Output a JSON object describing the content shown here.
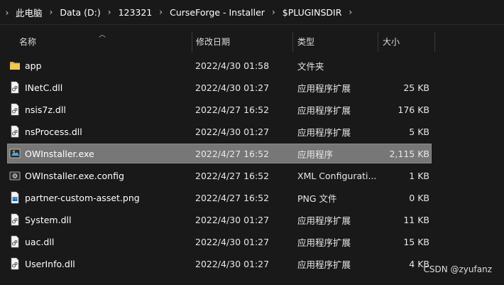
{
  "breadcrumb": {
    "items": [
      "此电脑",
      "Data (D:)",
      "123321",
      "CurseForge - Installer",
      "$PLUGINSDIR"
    ]
  },
  "columns": {
    "name": "名称",
    "date": "修改日期",
    "type": "类型",
    "size": "大小"
  },
  "files": [
    {
      "name": "app",
      "date": "2022/4/30 01:58",
      "type": "文件夹",
      "size": "",
      "icon": "folder-icon"
    },
    {
      "name": "INetC.dll",
      "date": "2022/4/30 01:27",
      "type": "应用程序扩展",
      "size": "25 KB",
      "icon": "dll-file-icon"
    },
    {
      "name": "nsis7z.dll",
      "date": "2022/4/27 16:52",
      "type": "应用程序扩展",
      "size": "176 KB",
      "icon": "dll-file-icon"
    },
    {
      "name": "nsProcess.dll",
      "date": "2022/4/30 01:27",
      "type": "应用程序扩展",
      "size": "5 KB",
      "icon": "dll-file-icon"
    },
    {
      "name": "OWInstaller.exe",
      "date": "2022/4/27 16:52",
      "type": "应用程序",
      "size": "2,115 KB",
      "icon": "exe-installer-icon",
      "selected": true
    },
    {
      "name": "OWInstaller.exe.config",
      "date": "2022/4/27 16:52",
      "type": "XML Configurati...",
      "size": "1 KB",
      "icon": "config-file-icon"
    },
    {
      "name": "partner-custom-asset.png",
      "date": "2022/4/27 16:52",
      "type": "PNG 文件",
      "size": "0 KB",
      "icon": "png-file-icon"
    },
    {
      "name": "System.dll",
      "date": "2022/4/30 01:27",
      "type": "应用程序扩展",
      "size": "11 KB",
      "icon": "dll-file-icon"
    },
    {
      "name": "uac.dll",
      "date": "2022/4/30 01:27",
      "type": "应用程序扩展",
      "size": "15 KB",
      "icon": "dll-file-icon"
    },
    {
      "name": "UserInfo.dll",
      "date": "2022/4/30 01:27",
      "type": "应用程序扩展",
      "size": "4 KB",
      "icon": "dll-file-icon"
    }
  ],
  "watermark": "CSDN @zyufanz",
  "colors": {
    "background": "#191919",
    "selection": "#777777",
    "folder": "#e8b84a"
  }
}
